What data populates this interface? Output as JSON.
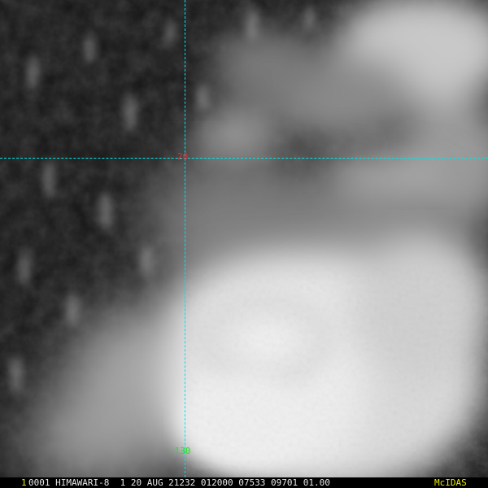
{
  "image": {
    "description_kind": "visible-satellite-imagery",
    "scene_palette": {
      "ocean": "#151515",
      "cloud_bright": "#f0f0f0",
      "cloud_mid": "#9a9a9a"
    }
  },
  "overlay": {
    "grid_color": "#00e5e5",
    "latitude_label": "20",
    "latitude_label_color": "#e03030",
    "longitude_label": "-130",
    "longitude_label_color": "#19e519"
  },
  "caption": {
    "frame_number": "1",
    "text": "0001 HIMAWARI-8  1 20 AUG 21232 012000 07533 09701 01.00",
    "logo": "McIDAS",
    "text_color": "#e6e6e6",
    "accent_color": "#e8e800"
  }
}
